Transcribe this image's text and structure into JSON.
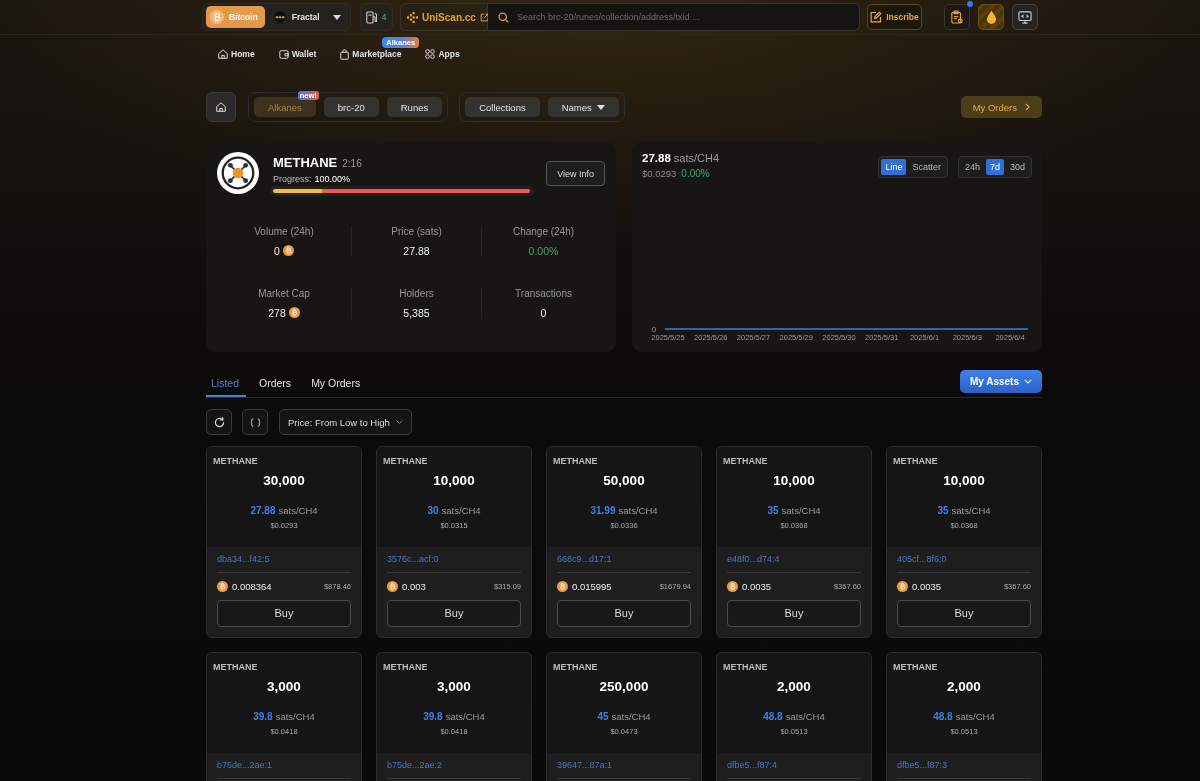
{
  "top_bar": {
    "networks": [
      {
        "label": "Bitcoin",
        "kind": "bitcoin",
        "selected": true
      },
      {
        "label": "Fractal",
        "kind": "fractal",
        "selected": false
      }
    ],
    "gas": "4",
    "explorer": "UniScan.cc",
    "search": {
      "placeholder": "Search brc-20/runes/collection/address/txid ..."
    },
    "inscribe": "Inscribe",
    "tools": [
      {
        "kind": "clipboard",
        "badge": true
      },
      {
        "kind": "drop",
        "badge": false
      },
      {
        "kind": "monitor",
        "badge": false
      }
    ]
  },
  "nav": [
    {
      "label": "Home",
      "kind": "home"
    },
    {
      "label": "Wallet",
      "kind": "wallet"
    },
    {
      "label": "Marketplace",
      "kind": "bag",
      "badge": "Alkanes"
    },
    {
      "label": "Apps",
      "kind": "apps"
    }
  ],
  "filters": {
    "protocols": [
      {
        "label": "Alkanes",
        "selected": true,
        "badge": "new!"
      },
      {
        "label": "brc-20",
        "selected": false
      },
      {
        "label": "Runes",
        "selected": false
      }
    ],
    "catalogs": [
      {
        "label": "Collections",
        "dropdown": false
      },
      {
        "label": "Names",
        "dropdown": true
      }
    ],
    "my_orders": "My Orders"
  },
  "token": {
    "name": "METHANE",
    "id": "2:16",
    "progress_label": "Progress:",
    "progress_value": "100.00%",
    "level": 1,
    "view_info": "View Info",
    "stats": [
      {
        "label": "Volume (24h)",
        "value": "0",
        "kind": "coin"
      },
      {
        "label": "Price (sats)",
        "value": "27.88",
        "kind": "plain"
      },
      {
        "label": "Change (24h)",
        "value": "0.00%",
        "kind": "change"
      },
      {
        "label": "Market Cap",
        "value": "278",
        "kind": "coin"
      },
      {
        "label": "Holders",
        "value": "5,385",
        "kind": "plain"
      },
      {
        "label": "Transactions",
        "value": "0",
        "kind": "plain"
      }
    ]
  },
  "chart": {
    "price": "27.88",
    "unit": "sats/CH4",
    "usd": "$0.0293",
    "change": "0.00%",
    "modes": [
      {
        "label": "Line",
        "selected": true
      },
      {
        "label": "Scatter",
        "selected": false
      }
    ],
    "ranges": [
      {
        "label": "24h",
        "selected": false
      },
      {
        "label": "7d",
        "selected": true
      },
      {
        "label": "30d",
        "selected": false
      }
    ],
    "y_tick": "0",
    "x_labels": [
      "2025/5/25",
      "2025/5/26",
      "2025/5/27",
      "2025/5/29",
      "2025/5/30",
      "2025/5/31",
      "2025/6/1",
      "2025/6/3",
      "2025/6/4"
    ]
  },
  "tabs": [
    {
      "label": "Listed",
      "selected": true
    },
    {
      "label": "Orders",
      "selected": false
    },
    {
      "label": "My Orders",
      "selected": false
    }
  ],
  "assets_button": "My Assets",
  "sort": "Price: From Low to High",
  "listings": [
    {
      "ticker": "METHANE",
      "amount": "30,000",
      "price": "27.88",
      "unit": "sats/CH4",
      "usd": "$0.0293",
      "outpoint": "dba34...f42:5",
      "btc": "0.008364",
      "total_usd": "$878.46",
      "action": "Buy"
    },
    {
      "ticker": "METHANE",
      "amount": "10,000",
      "price": "30",
      "unit": "sats/CH4",
      "usd": "$0.0315",
      "outpoint": "3576c...acf:0",
      "btc": "0.003",
      "total_usd": "$315.09",
      "action": "Buy"
    },
    {
      "ticker": "METHANE",
      "amount": "50,000",
      "price": "31.99",
      "unit": "sats/CH4",
      "usd": "$0.0336",
      "outpoint": "668c9...d17:1",
      "btc": "0.015995",
      "total_usd": "$1679.94",
      "action": "Buy"
    },
    {
      "ticker": "METHANE",
      "amount": "10,000",
      "price": "35",
      "unit": "sats/CH4",
      "usd": "$0.0368",
      "outpoint": "e48f0...d74:4",
      "btc": "0.0035",
      "total_usd": "$367.60",
      "action": "Buy"
    },
    {
      "ticker": "METHANE",
      "amount": "10,000",
      "price": "35",
      "unit": "sats/CH4",
      "usd": "$0.0368",
      "outpoint": "405cf...8f6:0",
      "btc": "0.0035",
      "total_usd": "$367.60",
      "action": "Buy"
    },
    {
      "ticker": "METHANE",
      "amount": "3,000",
      "price": "39.8",
      "unit": "sats/CH4",
      "usd": "$0.0418",
      "outpoint": "b75de...2ae:1"
    },
    {
      "ticker": "METHANE",
      "amount": "3,000",
      "price": "39.8",
      "unit": "sats/CH4",
      "usd": "$0.0418",
      "outpoint": "b75de...2ae:2"
    },
    {
      "ticker": "METHANE",
      "amount": "250,000",
      "price": "45",
      "unit": "sats/CH4",
      "usd": "$0.0473",
      "outpoint": "39647...87a:1"
    },
    {
      "ticker": "METHANE",
      "amount": "2,000",
      "price": "48.8",
      "unit": "sats/CH4",
      "usd": "$0.0513",
      "outpoint": "dfbe5...f87:4"
    },
    {
      "ticker": "METHANE",
      "amount": "2,000",
      "price": "48.8",
      "unit": "sats/CH4",
      "usd": "$0.0513",
      "outpoint": "dfbe5...f87:3"
    }
  ]
}
